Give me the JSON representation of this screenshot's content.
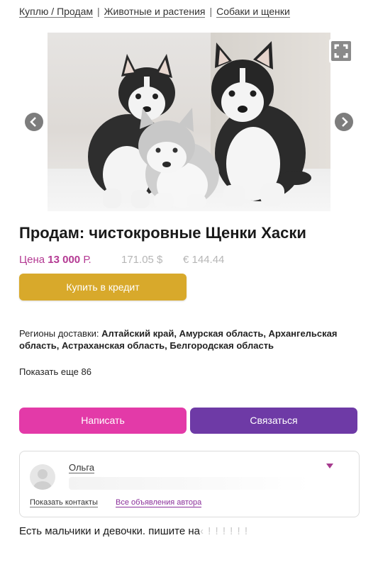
{
  "breadcrumbs": [
    "Куплю / Продам",
    "Животные и растения",
    "Собаки и щенки"
  ],
  "gallery": {
    "prev_icon": "chevron-left-icon",
    "next_icon": "chevron-right-icon",
    "expand_icon": "fullscreen-icon"
  },
  "listing": {
    "title": "Продам: чистокровные Щенки Хаски",
    "price_label": "Цена",
    "price_value": "13 000",
    "price_currency": "Р.",
    "price_usd": "171.05 $",
    "price_eur": "€ 144.44"
  },
  "credit_button": "Купить в кредит",
  "delivery": {
    "label": "Регионы доставки:",
    "regions": "Алтайский край, Амурская область, Архангельская область, Астраханская область, Белгородская область",
    "show_more": "Показать еще 86"
  },
  "actions": {
    "write": "Написать",
    "contact": "Связаться"
  },
  "seller": {
    "name": "Ольга",
    "show_contacts": "Показать контакты",
    "all_ads": "Все объявления автора"
  },
  "description": {
    "text": "Есть мальчики и девочки. пишите на",
    "fade": "‹ ! ! ! ! ! !"
  },
  "colors": {
    "accent_pink": "#e33aa8",
    "accent_purple": "#6e3aa6",
    "credit": "#d8a92b",
    "price": "#b43a93"
  }
}
